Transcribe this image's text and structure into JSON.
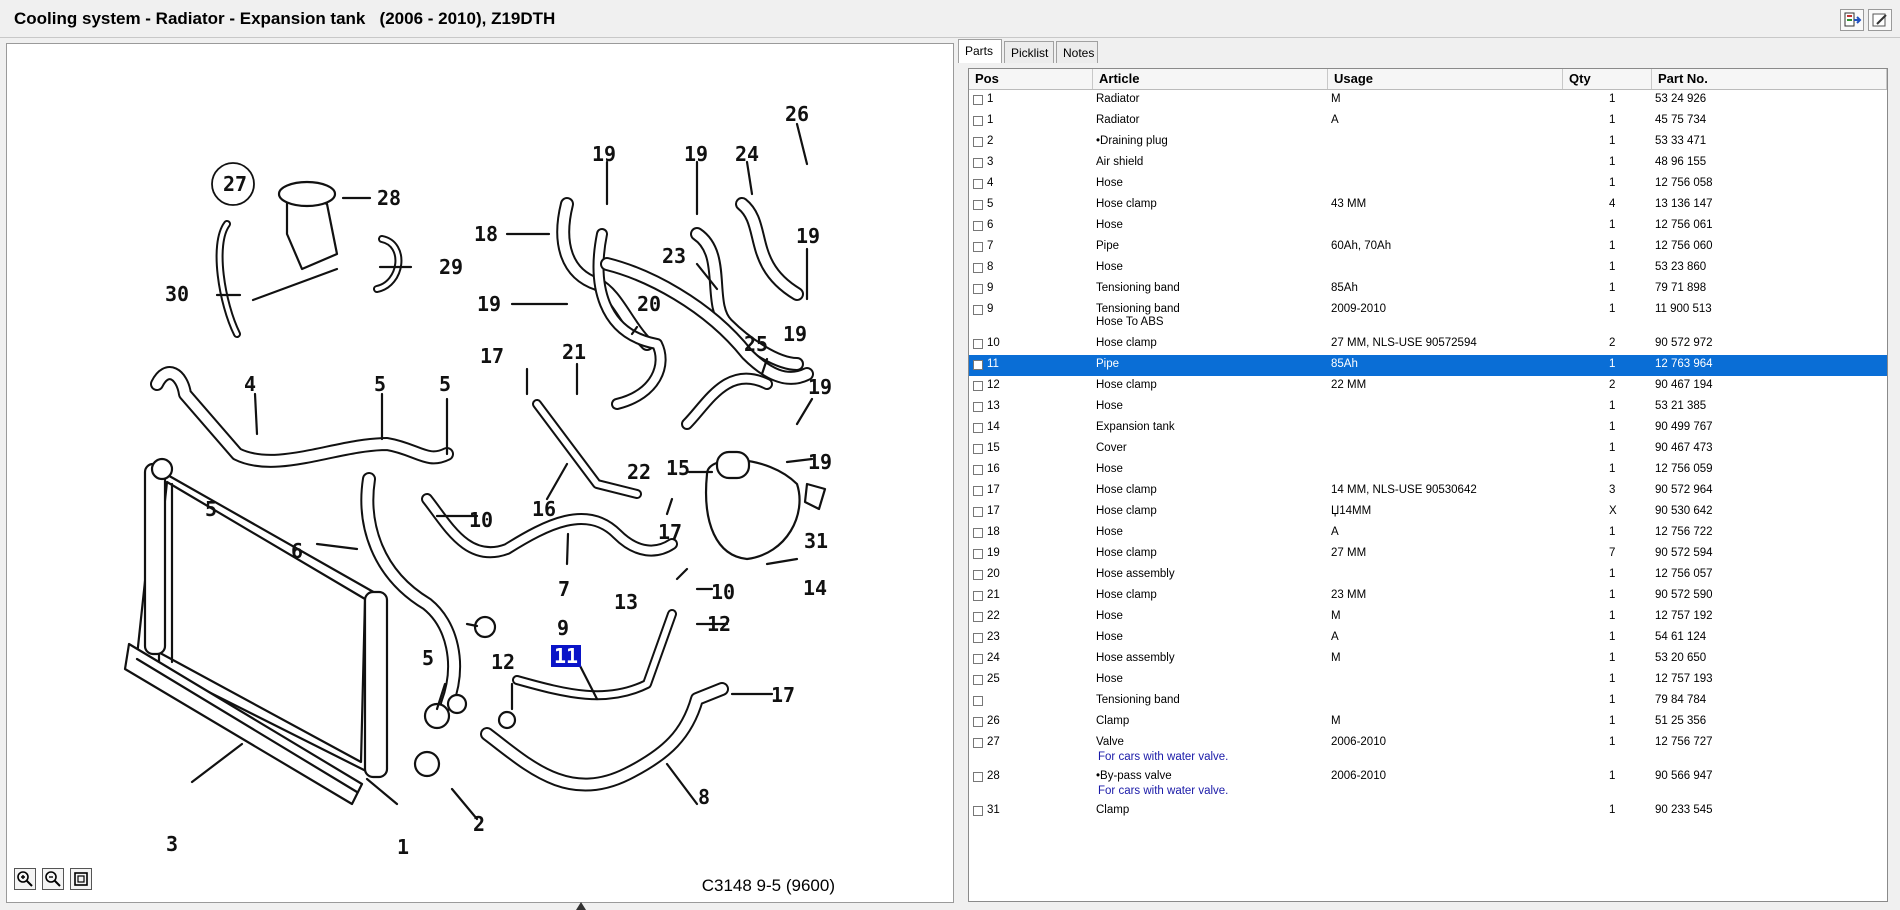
{
  "window": {
    "title": "Cooling system - Radiator - Expansion tank   (2006 - 2010), Z19DTH"
  },
  "toolbar": {
    "icons": [
      "export-icon",
      "edit-icon"
    ]
  },
  "diagram": {
    "reference": "C3148 9-5 (9600)",
    "callouts": [
      "27",
      "28",
      "29",
      "30",
      "26",
      "19",
      "19",
      "24",
      "18",
      "19",
      "23",
      "20",
      "19",
      "25",
      "19",
      "21",
      "17",
      "4",
      "5",
      "5",
      "19",
      "19",
      "22",
      "15",
      "16",
      "5",
      "10",
      "17",
      "31",
      "6",
      "7",
      "14",
      "10",
      "13",
      "12",
      "9",
      "11",
      "5",
      "12",
      "17",
      "8",
      "3",
      "1",
      "2"
    ],
    "selected_callout": "11"
  },
  "tabs": [
    "Parts",
    "Picklist",
    "Notes"
  ],
  "table": {
    "headers": [
      "Pos",
      "Article",
      "Usage",
      "Qty",
      "Part No."
    ],
    "rows": [
      {
        "pos": "1",
        "article": "Radiator",
        "usage": "M",
        "qty": "1",
        "part": "53 24 926"
      },
      {
        "pos": "1",
        "article": "Radiator",
        "usage": "A",
        "qty": "1",
        "part": "45 75 734"
      },
      {
        "pos": "2",
        "article": "•Draining plug",
        "usage": "",
        "qty": "1",
        "part": "53 33 471"
      },
      {
        "pos": "3",
        "article": "Air shield",
        "usage": "",
        "qty": "1",
        "part": "48 96 155"
      },
      {
        "pos": "4",
        "article": "Hose",
        "usage": "",
        "qty": "1",
        "part": "12 756 058"
      },
      {
        "pos": "5",
        "article": "Hose clamp",
        "usage": "43 MM",
        "qty": "4",
        "part": "13 136 147"
      },
      {
        "pos": "6",
        "article": "Hose",
        "usage": "",
        "qty": "1",
        "part": "12 756 061"
      },
      {
        "pos": "7",
        "article": "Pipe",
        "usage": "60Ah, 70Ah",
        "qty": "1",
        "part": "12 756 060"
      },
      {
        "pos": "8",
        "article": "Hose",
        "usage": "",
        "qty": "1",
        "part": "53 23 860"
      },
      {
        "pos": "9",
        "article": "Tensioning band",
        "usage": "85Ah",
        "qty": "1",
        "part": "79 71 898"
      },
      {
        "pos": "9",
        "article": "Tensioning band",
        "article2": "Hose  To  ABS",
        "usage": "2009-2010",
        "qty": "1",
        "part": "11 900 513"
      },
      {
        "pos": "10",
        "article": "Hose clamp",
        "usage": "27 MM, NLS-USE 90572594",
        "qty": "2",
        "part": "90 572 972"
      },
      {
        "pos": "11",
        "article": "Pipe",
        "usage": "85Ah",
        "qty": "1",
        "part": "12 763 964",
        "selected": true
      },
      {
        "pos": "12",
        "article": "Hose clamp",
        "usage": "22 MM",
        "qty": "2",
        "part": "90 467 194"
      },
      {
        "pos": "13",
        "article": "Hose",
        "usage": "",
        "qty": "1",
        "part": "53 21 385"
      },
      {
        "pos": "14",
        "article": "Expansion tank",
        "usage": "",
        "qty": "1",
        "part": "90 499 767"
      },
      {
        "pos": "15",
        "article": "Cover",
        "usage": "",
        "qty": "1",
        "part": "90 467 473"
      },
      {
        "pos": "16",
        "article": "Hose",
        "usage": "",
        "qty": "1",
        "part": "12 756 059"
      },
      {
        "pos": "17",
        "article": "Hose clamp",
        "usage": "14 MM, NLS-USE 90530642",
        "qty": "3",
        "part": "90 572 964"
      },
      {
        "pos": "17",
        "article": "Hose clamp",
        "usage": "Џ14MM",
        "qty": "X",
        "part": "90 530 642"
      },
      {
        "pos": "18",
        "article": "Hose",
        "usage": "A",
        "qty": "1",
        "part": "12 756 722"
      },
      {
        "pos": "19",
        "article": "Hose clamp",
        "usage": "27 MM",
        "qty": "7",
        "part": "90 572 594"
      },
      {
        "pos": "20",
        "article": "Hose assembly",
        "usage": "",
        "qty": "1",
        "part": "12 756 057"
      },
      {
        "pos": "21",
        "article": "Hose clamp",
        "usage": "23 MM",
        "qty": "1",
        "part": "90 572 590"
      },
      {
        "pos": "22",
        "article": "Hose",
        "usage": "M",
        "qty": "1",
        "part": "12 757 192"
      },
      {
        "pos": "23",
        "article": "Hose",
        "usage": "A",
        "qty": "1",
        "part": "54 61 124"
      },
      {
        "pos": "24",
        "article": "Hose assembly",
        "usage": "M",
        "qty": "1",
        "part": "53 20 650"
      },
      {
        "pos": "25",
        "article": "Hose",
        "usage": "",
        "qty": "1",
        "part": "12 757 193"
      },
      {
        "pos": "",
        "article": "Tensioning band",
        "usage": "",
        "qty": "1",
        "part": "79 84 784"
      },
      {
        "pos": "26",
        "article": "Clamp",
        "usage": "M",
        "qty": "1",
        "part": "51 25 356"
      },
      {
        "pos": "27",
        "article": "Valve",
        "note": "For cars with water valve.",
        "usage": "2006-2010",
        "qty": "1",
        "part": "12 756 727"
      },
      {
        "pos": "28",
        "article": "•By-pass valve",
        "note": "For cars with water valve.",
        "usage": "2006-2010",
        "qty": "1",
        "part": "90 566 947"
      },
      {
        "pos": "31",
        "article": "Clamp",
        "usage": "",
        "qty": "1",
        "part": "90 233 545"
      }
    ]
  },
  "colors": {
    "selection": "#0a6ed6",
    "callout_highlight": "#0a14c8",
    "note_text": "#1a1aa8"
  }
}
